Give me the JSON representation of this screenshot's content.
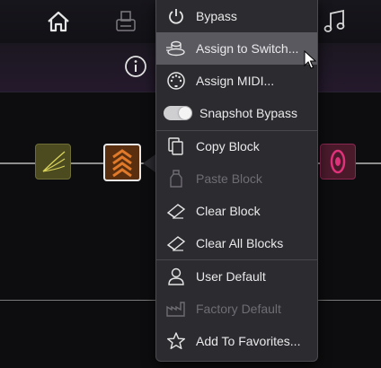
{
  "menu": {
    "items": [
      {
        "label": "Bypass",
        "icon": "power-icon",
        "enabled": true
      },
      {
        "label": "Assign to Switch...",
        "icon": "footswitch-icon",
        "enabled": true,
        "highlighted": true
      },
      {
        "label": "Assign MIDI...",
        "icon": "midi-icon",
        "enabled": true
      },
      {
        "label": "Snapshot Bypass",
        "icon": "toggle-icon",
        "enabled": true,
        "toggle_on": true
      },
      {
        "label": "Copy Block",
        "icon": "copy-icon",
        "enabled": true
      },
      {
        "label": "Paste Block",
        "icon": "paste-icon",
        "enabled": false
      },
      {
        "label": "Clear Block",
        "icon": "eraser-icon",
        "enabled": true
      },
      {
        "label": "Clear All Blocks",
        "icon": "eraser-icon",
        "enabled": true
      },
      {
        "label": "User Default",
        "icon": "user-icon",
        "enabled": true
      },
      {
        "label": "Factory Default",
        "icon": "factory-icon",
        "enabled": false
      },
      {
        "label": "Add To Favorites...",
        "icon": "star-icon",
        "enabled": true
      }
    ]
  },
  "toolbar": {
    "icons": [
      "home-icon",
      "printer-icon",
      "music-note-icon",
      "info-icon"
    ]
  },
  "colors": {
    "menu_bg": "#2c2b30",
    "highlight": "#5a5960",
    "selected_block": "#5a2f0f",
    "selected_block_accent": "#e07a2a",
    "dist_block": "#4c4b1f",
    "cab_block": "#4a1a2b",
    "cab_accent": "#e0327a"
  }
}
